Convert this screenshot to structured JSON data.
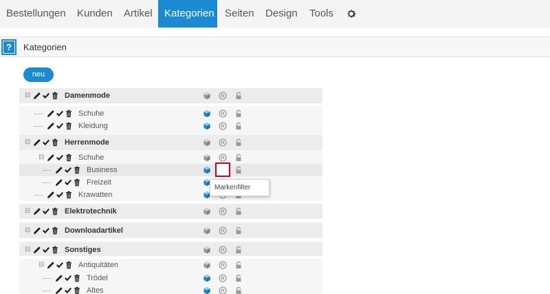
{
  "nav": {
    "items": [
      "Bestellungen",
      "Kunden",
      "Artikel",
      "Kategorien",
      "Seiten",
      "Design",
      "Tools"
    ],
    "active": "Kategorien",
    "settings_icon": "gear-icon"
  },
  "section": {
    "help_label": "?",
    "title": "Kategorien"
  },
  "new_button": "neu",
  "tree": [
    {
      "label": "Damenmode",
      "level": 0
    },
    {
      "label": "Schuhe",
      "level": 1
    },
    {
      "label": "Kleidung",
      "level": 1
    },
    {
      "label": "Herrenmode",
      "level": 0
    },
    {
      "label": "Schuhe",
      "level": 1
    },
    {
      "label": "Business",
      "level": 2
    },
    {
      "label": "Freizeit",
      "level": 2
    },
    {
      "label": "Krawatten",
      "level": 1
    },
    {
      "label": "Elektrotechnik",
      "level": 0
    },
    {
      "label": "Downloadartikel",
      "level": 0
    },
    {
      "label": "Sonstiges",
      "level": 0
    },
    {
      "label": "Antiquitäten",
      "level": 1
    },
    {
      "label": "Trödel",
      "level": 2
    },
    {
      "label": "Altes",
      "level": 2
    }
  ],
  "tooltip": "Markenfilter",
  "colors": {
    "accent": "#1a8bd2",
    "highlight_border": "#d0021b"
  }
}
